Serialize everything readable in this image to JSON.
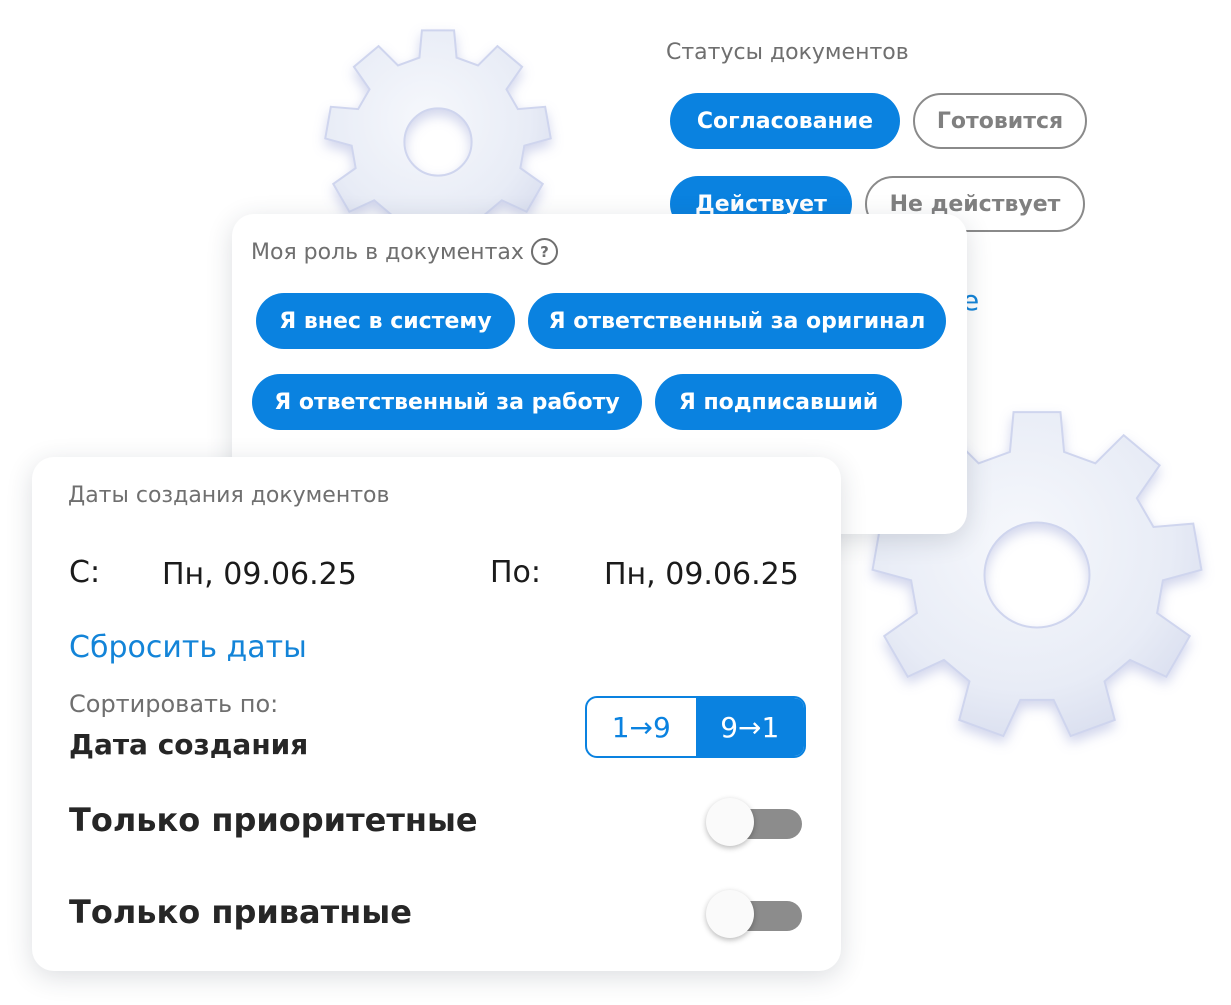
{
  "colors": {
    "accent": "#0a82e0",
    "link": "#1384d8",
    "muted_text": "#6f6f6f",
    "outline_chip": "#8a8a8a",
    "switch_track_off": "#8c8c8c",
    "gear": "#e8ecf6"
  },
  "statuses": {
    "title": "Статусы документов",
    "chips": [
      {
        "label": "Согласование",
        "active": true
      },
      {
        "label": "Готовится",
        "active": false
      },
      {
        "label": "Действует",
        "active": true
      },
      {
        "label": "Не действует",
        "active": false
      }
    ],
    "partial_link_text": "е"
  },
  "roles": {
    "title": "Моя роль в документах",
    "help_icon": "question-circle-icon",
    "help_glyph": "?",
    "chips": [
      {
        "label": "Я внес в систему",
        "active": true
      },
      {
        "label": "Я ответственный за оригинал",
        "active": true
      },
      {
        "label": "Я ответственный за работу",
        "active": true
      },
      {
        "label": "Я подписавший",
        "active": true
      }
    ]
  },
  "dates": {
    "title": "Даты создания документов",
    "from_label": "С:",
    "from_value": "Пн, 09.06.25",
    "to_label": "По:",
    "to_value": "Пн, 09.06.25",
    "reset_link": "Сбросить даты",
    "sort_label": "Сортировать по:",
    "sort_value": "Дата создания",
    "sort_asc": "1→9",
    "sort_desc": "9→1",
    "sort_selected": "desc",
    "priority_label": "Только приоритетные",
    "priority_on": false,
    "private_label": "Только приватные",
    "private_on": false
  },
  "icons": {
    "gear_small": "gear-icon",
    "gear_large": "gear-icon"
  }
}
